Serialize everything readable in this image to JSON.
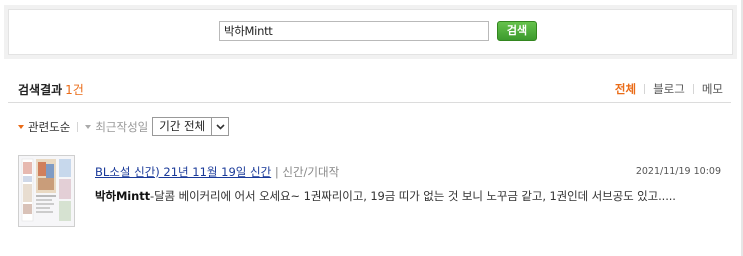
{
  "search": {
    "query": "박하Mintt",
    "button_label": "검색"
  },
  "results": {
    "label": "검색결과",
    "count": "1건"
  },
  "filters": {
    "tabs": [
      "전체",
      "블로그",
      "메모"
    ]
  },
  "sort": {
    "relevance": "관련도순",
    "recent": "최근작성일",
    "period": "기간 전체"
  },
  "items": [
    {
      "title": "BL소설 신간) 21년 11월 19일 신간",
      "category": "신간/기대작",
      "date": "2021/11/19 10:09",
      "snippet_highlight": "박하Mintt",
      "snippet_text": "-달콤 베이커리에 어서 오세요~ 1권짜리이고, 19금 띠가 없는 것 보니 노꾸금 같고, 1권인데 서브공도 있고....."
    }
  ],
  "colors": {
    "accent": "#ea6b17",
    "button_green": "#3c9a2d",
    "link": "#1a3a99"
  }
}
